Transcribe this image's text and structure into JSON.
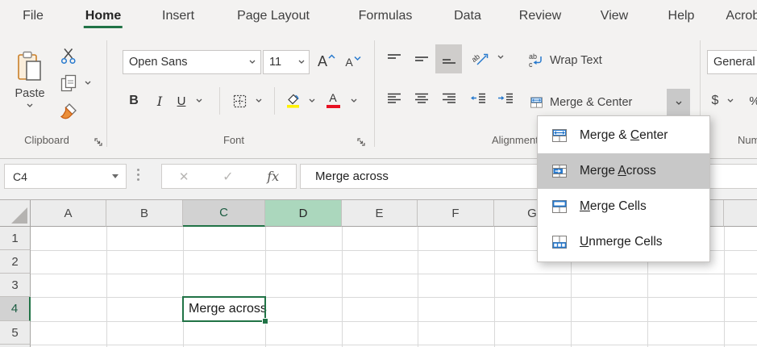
{
  "tabs": [
    {
      "label": "File"
    },
    {
      "label": "Home",
      "active": true
    },
    {
      "label": "Insert"
    },
    {
      "label": "Page Layout"
    },
    {
      "label": "Formulas"
    },
    {
      "label": "Data"
    },
    {
      "label": "Review"
    },
    {
      "label": "View"
    },
    {
      "label": "Help"
    },
    {
      "label": "Acrobat"
    }
  ],
  "ribbon": {
    "clipboard": {
      "group_label": "Clipboard",
      "paste_label": "Paste"
    },
    "font": {
      "group_label": "Font",
      "font_name": "Open Sans",
      "font_size": "11",
      "bold_glyph": "B",
      "italic_glyph": "I",
      "underline_glyph": "U",
      "grow_glyph": "A",
      "shrink_glyph": "A",
      "color_glyph": "A"
    },
    "alignment": {
      "group_label": "Alignment",
      "wrap_text_label": "Wrap Text",
      "merge_center_label": "Merge & Center"
    },
    "number": {
      "group_label": "Number",
      "number_format": "General",
      "currency_glyph": "$",
      "percent_glyph": "%"
    }
  },
  "formula_bar": {
    "name_box_value": "C4",
    "cancel_glyph": "✕",
    "enter_glyph": "✓",
    "fx_glyph": "fx",
    "formula_value": "Merge across"
  },
  "sheet": {
    "column_headers": [
      "A",
      "B",
      "C",
      "D",
      "E",
      "F",
      "G"
    ],
    "row_headers": [
      "1",
      "2",
      "3",
      "4",
      "5"
    ],
    "active_cell": {
      "ref": "C4",
      "value": "Merge across"
    },
    "selected_column": "C",
    "tinted_column": "D",
    "selected_row": "4"
  },
  "merge_menu": {
    "items": [
      {
        "pre": "Merge & ",
        "u": "C",
        "post": "enter",
        "selected": false
      },
      {
        "pre": "Merge ",
        "u": "A",
        "post": "cross",
        "selected": true
      },
      {
        "pre": "",
        "u": "M",
        "post": "erge Cells",
        "selected": false
      },
      {
        "pre": "",
        "u": "U",
        "post": "nmerge Cells",
        "selected": false
      }
    ]
  },
  "colors": {
    "accent_green": "#217346",
    "selection_border": "#217346",
    "menu_highlight_bg": "#c8c8c8",
    "selected_header_bg": "#d2d2d2",
    "tinted_header_bg": "#abd7bd",
    "icon_blue": "#2779cd",
    "fill_yellow": "#fff100",
    "font_color_red": "#e81123",
    "ribbon_bg": "#f3f2f1"
  }
}
